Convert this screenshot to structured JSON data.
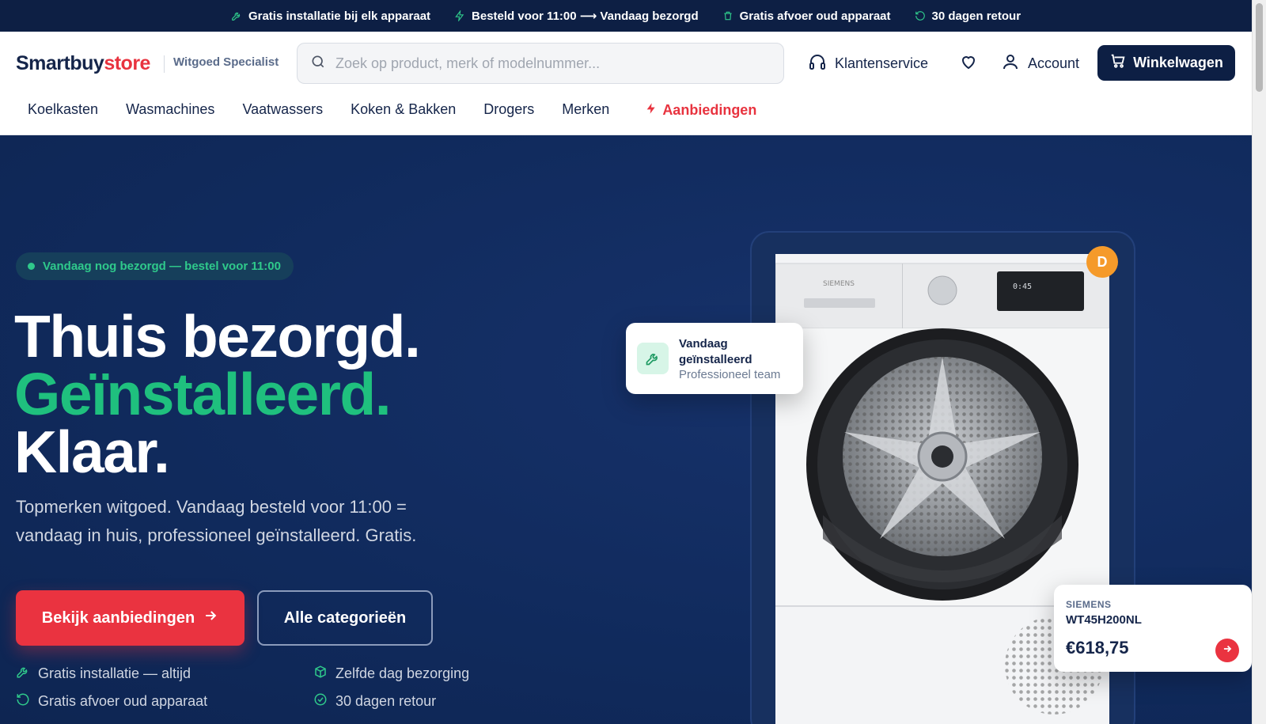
{
  "topbar": {
    "items": [
      {
        "icon": "wrench-icon",
        "label": "Gratis installatie bij elk apparaat"
      },
      {
        "icon": "lightning-icon",
        "label": "Besteld voor 11:00 ⟶ Vandaag bezorgd"
      },
      {
        "icon": "trash-icon",
        "label": "Gratis afvoer oud apparaat"
      },
      {
        "icon": "return-icon",
        "label": "30 dagen retour"
      }
    ]
  },
  "header": {
    "logo_part1": "Smartbuy",
    "logo_part2": "store",
    "tagline": "Witgoed Specialist",
    "search_placeholder": "Zoek op product, merk of modelnummer...",
    "search_value": "",
    "customer_service": "Klantenservice",
    "account": "Account",
    "cart": "Winkelwagen"
  },
  "nav": {
    "items": [
      "Koelkasten",
      "Wasmachines",
      "Vaatwassers",
      "Koken & Bakken",
      "Drogers",
      "Merken"
    ],
    "deals": "Aanbiedingen"
  },
  "hero": {
    "pill": "Vandaag nog bezorgd — bestel voor 11:00",
    "headline_1": "Thuis bezorgd.",
    "headline_2": "Geïnstalleerd.",
    "headline_3": "Klaar.",
    "lead": "Topmerken witgoed. Vandaag besteld voor 11:00 = vandaag in huis, professioneel geïnstalleerd. Gratis.",
    "cta_primary": "Bekijk aanbiedingen",
    "cta_secondary": "Alle categorieën",
    "usps": [
      {
        "icon": "wrench-icon",
        "label": "Gratis installatie — altijd"
      },
      {
        "icon": "box-icon",
        "label": "Zelfde dag bezorging"
      },
      {
        "icon": "return-icon",
        "label": "Gratis afvoer oud apparaat"
      },
      {
        "icon": "check-circle-icon",
        "label": "30 dagen retour"
      }
    ]
  },
  "product": {
    "energy_label": "D",
    "install_card_title": "Vandaag geïnstalleerd",
    "install_card_subtitle": "Professioneel team",
    "brand": "SIEMENS",
    "model": "WT45H200NL",
    "price": "€618,75",
    "appliance_brand_print": "SIEMENS",
    "appliance_display": "0:45"
  },
  "colors": {
    "navy": "#0d1f44",
    "hero_bg": "#102a5c",
    "green": "#1fc07e",
    "red": "#ea3340",
    "orange": "#f59a2a"
  }
}
